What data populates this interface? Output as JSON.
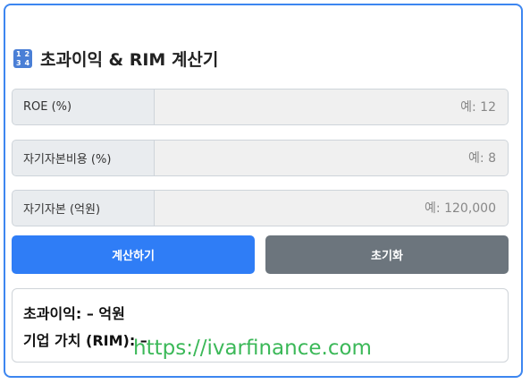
{
  "title": {
    "icon": "input-numbers-icon",
    "icon_digits": [
      "1",
      "2",
      "3",
      "4"
    ],
    "text": "초과이익 & RIM 계산기"
  },
  "fields": [
    {
      "label": "ROE (%)",
      "placeholder": "예: 12",
      "value": ""
    },
    {
      "label": "자기자본비용 (%)",
      "placeholder": "예: 8",
      "value": ""
    },
    {
      "label": "자기자본 (억원)",
      "placeholder": "예: 120,000",
      "value": ""
    }
  ],
  "buttons": {
    "calculate": "계산하기",
    "reset": "초기화"
  },
  "result": {
    "excess_profit": "초과이익: – 억원",
    "firm_value": "기업 가치 (RIM): –"
  },
  "watermark": "https://ivarfinance.com",
  "colors": {
    "accent": "#2f7df6",
    "border": "#3d86f0",
    "reset": "#6c757d",
    "watermark": "#2bb34a"
  }
}
